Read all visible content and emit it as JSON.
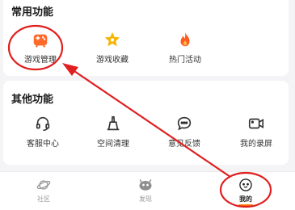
{
  "common": {
    "title": "常用功能",
    "items": [
      {
        "label": "游戏管理",
        "icon": "gamepad-icon"
      },
      {
        "label": "游戏收藏",
        "icon": "star-icon"
      },
      {
        "label": "热门活动",
        "icon": "flame-icon"
      }
    ]
  },
  "other": {
    "title": "其他功能",
    "items": [
      {
        "label": "客服中心",
        "icon": "headset-icon"
      },
      {
        "label": "空间清理",
        "icon": "broom-icon"
      },
      {
        "label": "意见反馈",
        "icon": "chat-bubble-icon"
      },
      {
        "label": "我的录屏",
        "icon": "screen-record-icon"
      }
    ]
  },
  "nav": {
    "tabs": [
      {
        "label": "社区",
        "icon": "planet-icon",
        "active": false
      },
      {
        "label": "发现",
        "icon": "discover-icon",
        "active": false
      },
      {
        "label": "我的",
        "icon": "face-icon",
        "active": true
      }
    ]
  },
  "colors": {
    "accent": "#ff7a00",
    "annotation": "#e02020",
    "star": "#f5b400",
    "gamepad": "#ff6a2a"
  }
}
